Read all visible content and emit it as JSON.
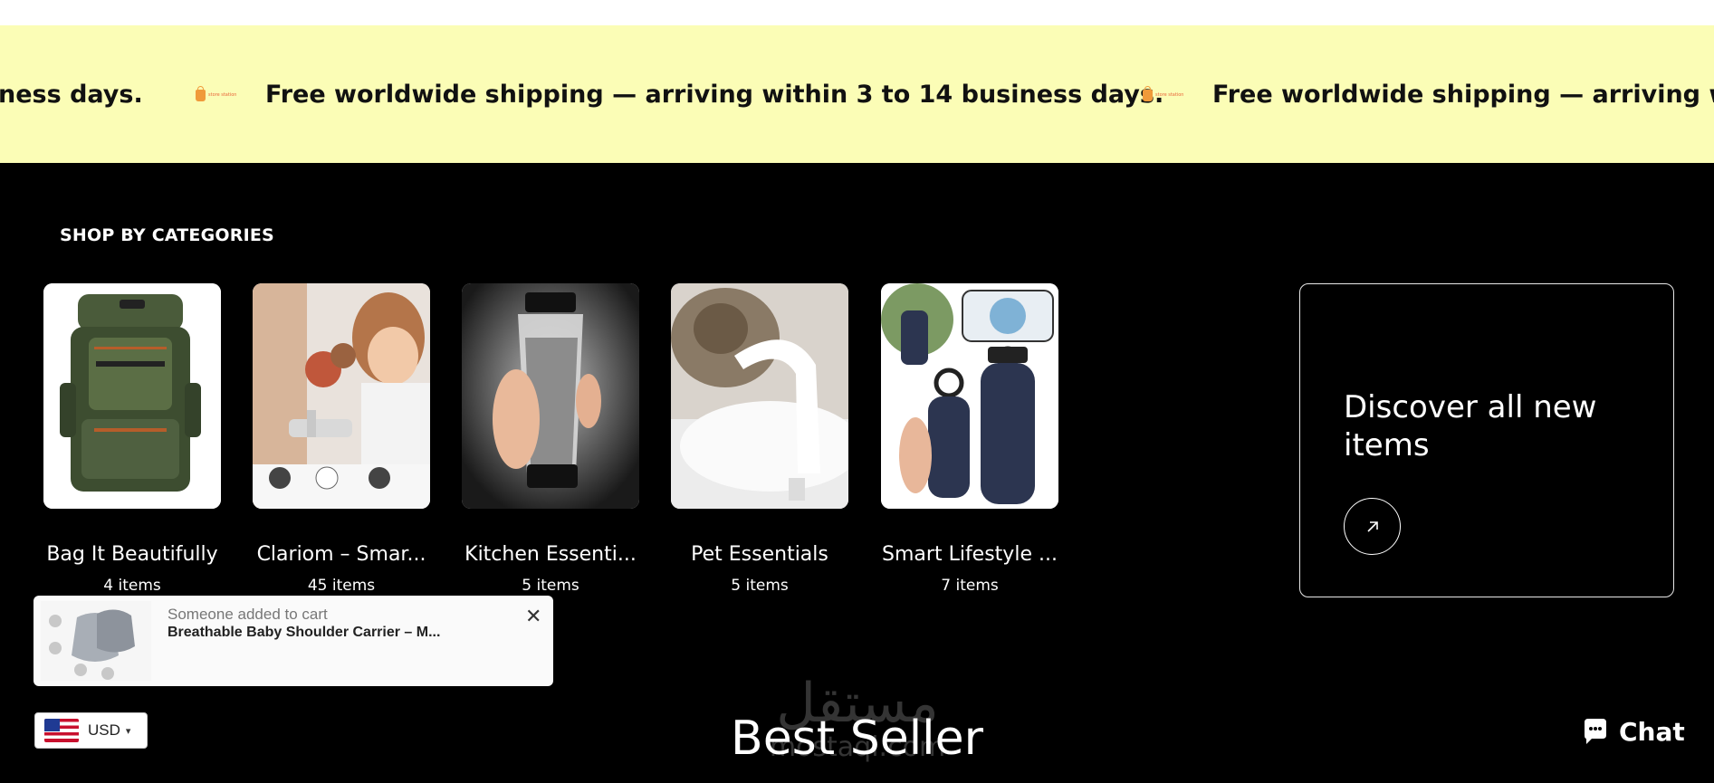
{
  "announcement": {
    "text": "Free worldwide shipping — arriving within 3 to 14 business days.",
    "partial_start": "ness days.",
    "logo_label": "store station"
  },
  "categories_section": {
    "title": "SHOP BY CATEGORIES",
    "items": [
      {
        "name": "Bag It Beautifully",
        "count": "4 items"
      },
      {
        "name": "Clariom – Smar...",
        "count": "45 items"
      },
      {
        "name": "Kitchen Essenti...",
        "count": "5 items"
      },
      {
        "name": "Pet Essentials",
        "count": "5 items"
      },
      {
        "name": "Smart Lifestyle ...",
        "count": "7 items"
      }
    ]
  },
  "discover": {
    "text": "Discover all new items",
    "icon": "arrow-up-right-icon"
  },
  "toast": {
    "line1": "Someone added to cart",
    "line2": "Breathable Baby Shoulder Carrier – M...",
    "close_icon": "close-icon"
  },
  "currency": {
    "label": "USD"
  },
  "best_seller": {
    "title": "Best Seller"
  },
  "chat": {
    "label": "Chat"
  },
  "colors": {
    "banner_bg": "#fbfdb6",
    "page_bg": "#000000",
    "text_light": "#ffffff"
  }
}
